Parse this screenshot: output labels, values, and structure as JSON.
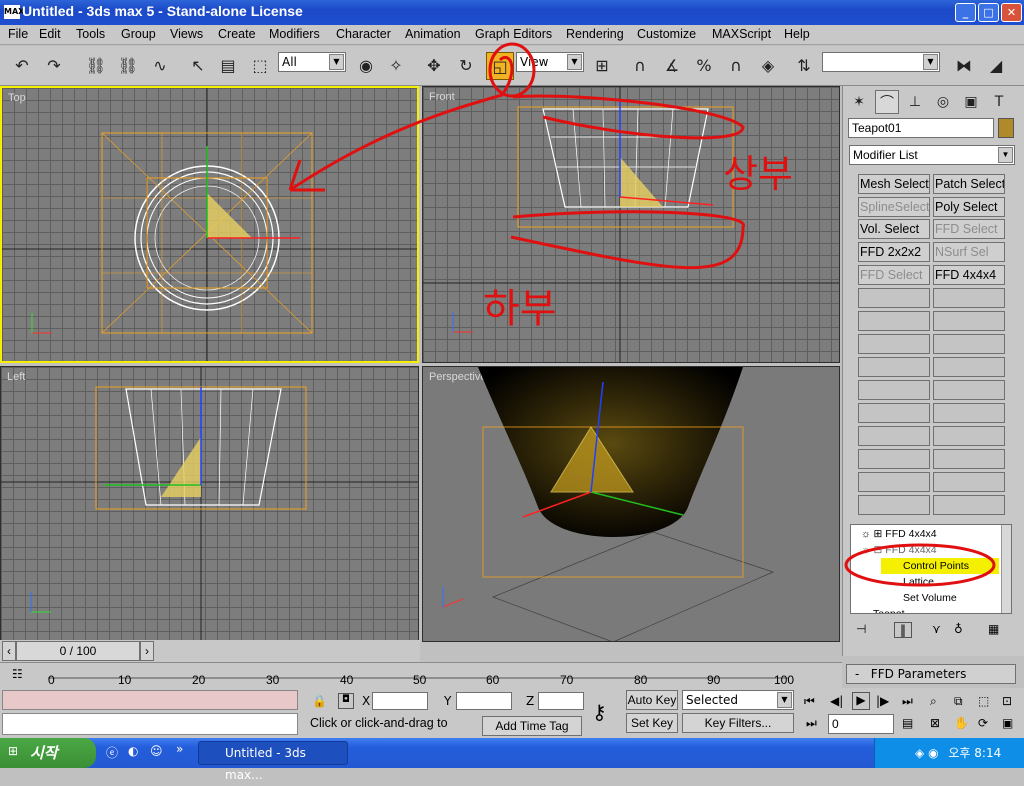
{
  "window": {
    "title": "Untitled - 3ds max 5 - Stand-alone License",
    "app_icon": "3ds-max-icon",
    "min": "_",
    "max": "□",
    "close": "✕"
  },
  "menu": [
    "File",
    "Edit",
    "Tools",
    "Group",
    "Views",
    "Create",
    "Modifiers",
    "Character",
    "Animation",
    "Graph Editors",
    "Rendering",
    "Customize",
    "MAXScript",
    "Help"
  ],
  "toolbar": {
    "selection_filter": "All",
    "ref_coord": "View"
  },
  "viewports": {
    "top": "Top",
    "front": "Front",
    "left": "Left",
    "perspective": "Perspective",
    "annotations": {
      "upper": "상부",
      "lower": "하부"
    }
  },
  "axes": {
    "x": "x",
    "y": "y",
    "z": "z"
  },
  "command_panel": {
    "object_name": "Teapot01",
    "object_color": "#b08a2a",
    "modifier_list": "Modifier List",
    "modifier_buttons": [
      {
        "label": "Mesh Select",
        "dim": false
      },
      {
        "label": "Patch Select",
        "dim": false
      },
      {
        "label": "SplineSelect",
        "dim": true
      },
      {
        "label": "Poly Select",
        "dim": false
      },
      {
        "label": "Vol. Select",
        "dim": false
      },
      {
        "label": "FFD Select",
        "dim": true
      },
      {
        "label": "FFD 2x2x2",
        "dim": false
      },
      {
        "label": "NSurf Sel",
        "dim": true
      },
      {
        "label": "FFD Select",
        "dim": true
      },
      {
        "label": "FFD 4x4x4",
        "dim": false
      }
    ],
    "stack": [
      {
        "label": "FFD 4x4x4",
        "level": 0
      },
      {
        "label": "FFD 4x4x4",
        "level": 0
      },
      {
        "label": "Control Points",
        "level": 1,
        "selected": true
      },
      {
        "label": "Lattice",
        "level": 1
      },
      {
        "label": "Set Volume",
        "level": 1
      },
      {
        "label": "Teapot",
        "level": 0
      }
    ],
    "rollout": "FFD Parameters"
  },
  "time": {
    "frame": "0 / 100",
    "ticks": [
      "0",
      "10",
      "20",
      "30",
      "40",
      "50",
      "60",
      "70",
      "80",
      "90",
      "100"
    ]
  },
  "status": {
    "x_label": "X",
    "y_label": "Y",
    "z_label": "Z",
    "prompt": "Click or click-and-drag to",
    "add_time_tag": "Add Time Tag",
    "auto_key": "Auto Key",
    "set_key": "Set Key",
    "selected": "Selected",
    "key_filters": "Key Filters...",
    "frame_field": "0"
  },
  "taskbar": {
    "start": "시작",
    "item": "Untitled - 3ds max...",
    "clock": "오후 8:14"
  }
}
